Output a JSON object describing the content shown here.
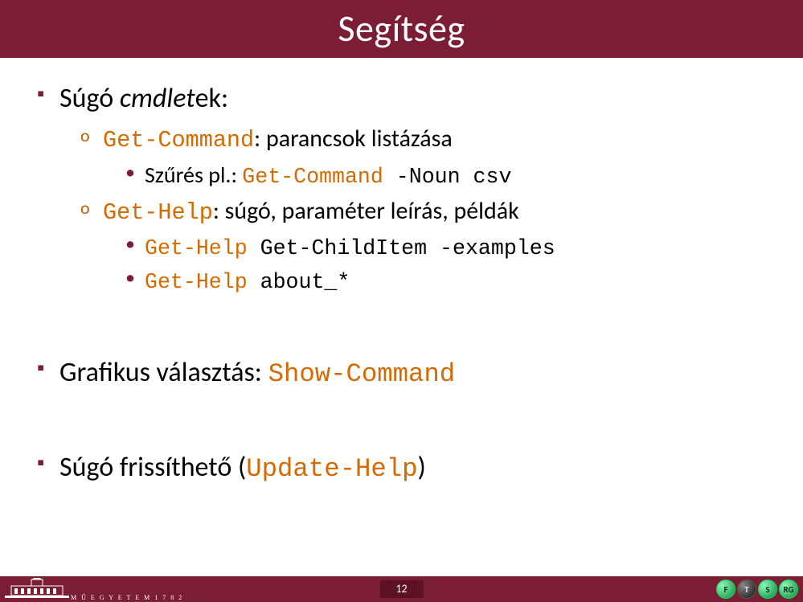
{
  "title": "Segítség",
  "bullets": {
    "b1": {
      "prefix": "Súgó ",
      "italic": "cmdlet",
      "suffix": "ek:"
    },
    "b1_a_cmd": "Get-Command",
    "b1_a_desc": ": parancsok listázása",
    "b1_a_i_prefix": "Szűrés pl.: ",
    "b1_a_i_cmd": "Get-Command",
    "b1_a_i_args": " -Noun csv",
    "b1_b_cmd": "Get-Help",
    "b1_b_desc": ": súgó, paraméter leírás, példák",
    "b1_b_i_cmd": "Get-Help",
    "b1_b_i_args": " Get-ChildItem -examples",
    "b1_b_ii_cmd": "Get-Help",
    "b1_b_ii_args": " about_*",
    "b2_prefix": "Grafikus választás: ",
    "b2_cmd": "Show-Command",
    "b3_prefix": "Súgó frissíthető (",
    "b3_cmd": "Update-Help",
    "b3_suffix": ")"
  },
  "footer": {
    "page": "12",
    "left_text": "M Ű E G Y E T E M   1 7 8 2",
    "badges": [
      "F",
      "T",
      "S",
      "RG"
    ]
  },
  "colors": {
    "brand": "#7b1e35",
    "cmd": "#d56a00"
  }
}
